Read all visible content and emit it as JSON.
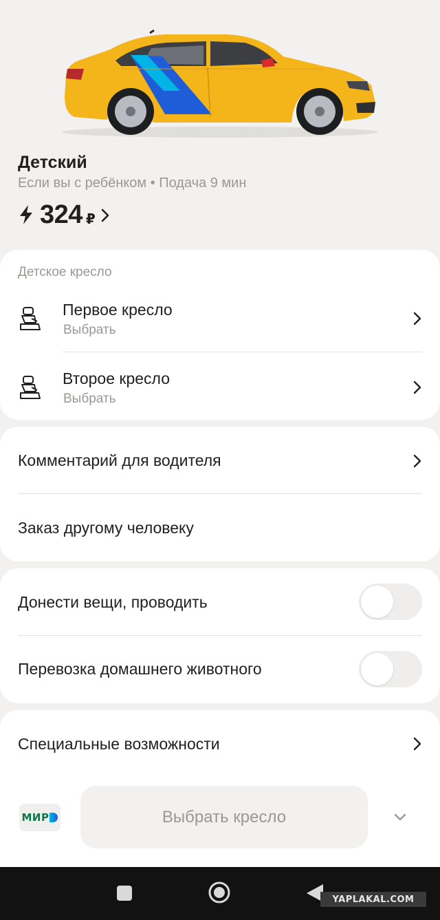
{
  "tariff": {
    "name": "Детский",
    "subtitle": "Если вы с ребёнком • Подача 9 мин",
    "price": "324",
    "currency": "₽"
  },
  "child_seats": {
    "label": "Детское кресло",
    "items": [
      {
        "title": "Первое кресло",
        "subtitle": "Выбрать"
      },
      {
        "title": "Второе кресло",
        "subtitle": "Выбрать"
      }
    ]
  },
  "options": {
    "comment": "Комментарий для водителя",
    "order_for_other": "Заказ другому человеку"
  },
  "toggles": [
    {
      "label": "Донести вещи, проводить",
      "on": false
    },
    {
      "label": "Перевозка домашнего животного",
      "on": false
    }
  ],
  "accessibility": {
    "label": "Специальные возможности"
  },
  "payment": {
    "method": "МИР",
    "cta": "Выбрать кресло"
  },
  "watermark": "YAPLAKAL.COM",
  "icons": {
    "bolt": "lightning-icon",
    "seat": "child-seat-icon",
    "chevron": "chevron-right-icon",
    "expand": "chevron-down-icon",
    "nav": [
      "square-icon",
      "circle-icon",
      "triangle-back-icon"
    ]
  },
  "colors": {
    "car_body": "#f4b51a",
    "stripe_blue": "#1f5cd7",
    "stripe_cyan": "#00b4e6",
    "background": "#f2f1ef",
    "card": "#ffffff",
    "muted_text": "#9b9894"
  }
}
